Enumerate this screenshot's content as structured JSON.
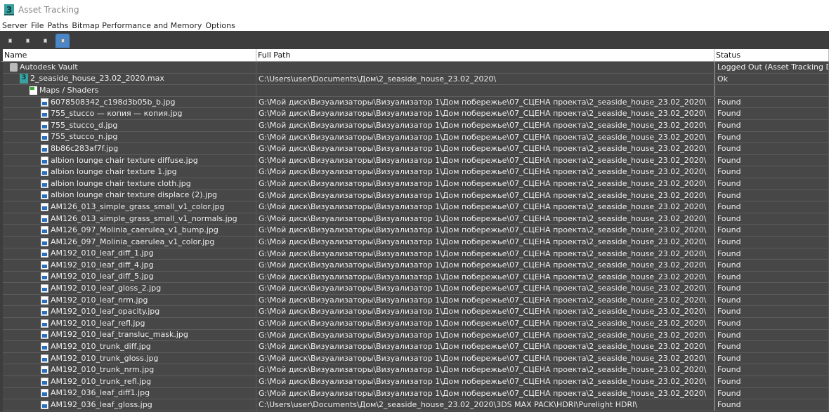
{
  "window": {
    "title": "Asset Tracking"
  },
  "menu": [
    "Server",
    "File",
    "Paths",
    "Bitmap Performance and Memory",
    "Options"
  ],
  "toolbar": {
    "buttons": [
      "status-view-button",
      "list-view-button",
      "refresh-button",
      "table-view-button"
    ],
    "active_index": 3
  },
  "columns": {
    "name": "Name",
    "path": "Full Path",
    "status": "Status"
  },
  "rows": [
    {
      "level": 0,
      "icon": "vault",
      "name": "Autodesk Vault",
      "path": "",
      "status": "Logged Out (Asset Tracking Disa"
    },
    {
      "level": 1,
      "icon": "max",
      "name": "2_seaside_house_23.02_2020.max",
      "path": "C:\\Users\\user\\Documents\\Дом\\2_seaside_house_23.02_2020\\",
      "status": "Ok"
    },
    {
      "level": 2,
      "icon": "maps",
      "name": "Maps / Shaders",
      "path": "",
      "status": ""
    },
    {
      "level": 3,
      "icon": "img",
      "name": "6078508342_c198d3b05b_b.jpg",
      "path": "G:\\Мой диск\\Визуализаторы\\Визуализатор 1\\Дом побережье\\07_СЦЕНА проекта\\2_seaside_house_23.02_2020\\",
      "status": "Found"
    },
    {
      "level": 3,
      "icon": "img",
      "name": "755_stucco — копия — копия.jpg",
      "path": "G:\\Мой диск\\Визуализаторы\\Визуализатор 1\\Дом побережье\\07_СЦЕНА проекта\\2_seaside_house_23.02_2020\\",
      "status": "Found"
    },
    {
      "level": 3,
      "icon": "img",
      "name": "755_stucco_d.jpg",
      "path": "G:\\Мой диск\\Визуализаторы\\Визуализатор 1\\Дом побережье\\07_СЦЕНА проекта\\2_seaside_house_23.02_2020\\",
      "status": "Found"
    },
    {
      "level": 3,
      "icon": "img",
      "name": "755_stucco_n.jpg",
      "path": "G:\\Мой диск\\Визуализаторы\\Визуализатор 1\\Дом побережье\\07_СЦЕНА проекта\\2_seaside_house_23.02_2020\\",
      "status": "Found"
    },
    {
      "level": 3,
      "icon": "img",
      "name": "8b86c283af7f.jpg",
      "path": "G:\\Мой диск\\Визуализаторы\\Визуализатор 1\\Дом побережье\\07_СЦЕНА проекта\\2_seaside_house_23.02_2020\\",
      "status": "Found"
    },
    {
      "level": 3,
      "icon": "img",
      "name": "albion lounge chair texture  diffuse.jpg",
      "path": "G:\\Мой диск\\Визуализаторы\\Визуализатор 1\\Дом побережье\\07_СЦЕНА проекта\\2_seaside_house_23.02_2020\\",
      "status": "Found"
    },
    {
      "level": 3,
      "icon": "img",
      "name": "albion lounge chair texture 1.jpg",
      "path": "G:\\Мой диск\\Визуализаторы\\Визуализатор 1\\Дом побережье\\07_СЦЕНА проекта\\2_seaside_house_23.02_2020\\",
      "status": "Found"
    },
    {
      "level": 3,
      "icon": "img",
      "name": "albion lounge chair texture cloth.jpg",
      "path": "G:\\Мой диск\\Визуализаторы\\Визуализатор 1\\Дом побережье\\07_СЦЕНА проекта\\2_seaside_house_23.02_2020\\",
      "status": "Found"
    },
    {
      "level": 3,
      "icon": "img",
      "name": "albion lounge chair texture displace (2).jpg",
      "path": "G:\\Мой диск\\Визуализаторы\\Визуализатор 1\\Дом побережье\\07_СЦЕНА проекта\\2_seaside_house_23.02_2020\\",
      "status": "Found"
    },
    {
      "level": 3,
      "icon": "img",
      "name": "AM126_013_simple_grass_small_v1_color.jpg",
      "path": "G:\\Мой диск\\Визуализаторы\\Визуализатор 1\\Дом побережье\\07_СЦЕНА проекта\\2_seaside_house_23.02_2020\\",
      "status": "Found"
    },
    {
      "level": 3,
      "icon": "img",
      "name": "AM126_013_simple_grass_small_v1_normals.jpg",
      "path": "G:\\Мой диск\\Визуализаторы\\Визуализатор 1\\Дом побережье\\07_СЦЕНА проекта\\2_seaside_house_23.02_2020\\",
      "status": "Found"
    },
    {
      "level": 3,
      "icon": "img",
      "name": "AM126_097_Molinia_caerulea_v1_bump.jpg",
      "path": "G:\\Мой диск\\Визуализаторы\\Визуализатор 1\\Дом побережье\\07_СЦЕНА проекта\\2_seaside_house_23.02_2020\\",
      "status": "Found"
    },
    {
      "level": 3,
      "icon": "img",
      "name": "AM126_097_Molinia_caerulea_v1_color.jpg",
      "path": "G:\\Мой диск\\Визуализаторы\\Визуализатор 1\\Дом побережье\\07_СЦЕНА проекта\\2_seaside_house_23.02_2020\\",
      "status": "Found"
    },
    {
      "level": 3,
      "icon": "img",
      "name": "AM192_010_leaf_diff_1.jpg",
      "path": "G:\\Мой диск\\Визуализаторы\\Визуализатор 1\\Дом побережье\\07_СЦЕНА проекта\\2_seaside_house_23.02_2020\\",
      "status": "Found"
    },
    {
      "level": 3,
      "icon": "img",
      "name": "AM192_010_leaf_diff_4.jpg",
      "path": "G:\\Мой диск\\Визуализаторы\\Визуализатор 1\\Дом побережье\\07_СЦЕНА проекта\\2_seaside_house_23.02_2020\\",
      "status": "Found"
    },
    {
      "level": 3,
      "icon": "img",
      "name": "AM192_010_leaf_diff_5.jpg",
      "path": "G:\\Мой диск\\Визуализаторы\\Визуализатор 1\\Дом побережье\\07_СЦЕНА проекта\\2_seaside_house_23.02_2020\\",
      "status": "Found"
    },
    {
      "level": 3,
      "icon": "img",
      "name": "AM192_010_leaf_gloss_2.jpg",
      "path": "G:\\Мой диск\\Визуализаторы\\Визуализатор 1\\Дом побережье\\07_СЦЕНА проекта\\2_seaside_house_23.02_2020\\",
      "status": "Found"
    },
    {
      "level": 3,
      "icon": "img",
      "name": "AM192_010_leaf_nrm.jpg",
      "path": "G:\\Мой диск\\Визуализаторы\\Визуализатор 1\\Дом побережье\\07_СЦЕНА проекта\\2_seaside_house_23.02_2020\\",
      "status": "Found"
    },
    {
      "level": 3,
      "icon": "img",
      "name": "AM192_010_leaf_opacity.jpg",
      "path": "G:\\Мой диск\\Визуализаторы\\Визуализатор 1\\Дом побережье\\07_СЦЕНА проекта\\2_seaside_house_23.02_2020\\",
      "status": "Found"
    },
    {
      "level": 3,
      "icon": "img",
      "name": "AM192_010_leaf_refl.jpg",
      "path": "G:\\Мой диск\\Визуализаторы\\Визуализатор 1\\Дом побережье\\07_СЦЕНА проекта\\2_seaside_house_23.02_2020\\",
      "status": "Found"
    },
    {
      "level": 3,
      "icon": "img",
      "name": "AM192_010_leaf_transluc_mask.jpg",
      "path": "G:\\Мой диск\\Визуализаторы\\Визуализатор 1\\Дом побережье\\07_СЦЕНА проекта\\2_seaside_house_23.02_2020\\",
      "status": "Found"
    },
    {
      "level": 3,
      "icon": "img",
      "name": "AM192_010_trunk_diff.jpg",
      "path": "G:\\Мой диск\\Визуализаторы\\Визуализатор 1\\Дом побережье\\07_СЦЕНА проекта\\2_seaside_house_23.02_2020\\",
      "status": "Found"
    },
    {
      "level": 3,
      "icon": "img",
      "name": "AM192_010_trunk_gloss.jpg",
      "path": "G:\\Мой диск\\Визуализаторы\\Визуализатор 1\\Дом побережье\\07_СЦЕНА проекта\\2_seaside_house_23.02_2020\\",
      "status": "Found"
    },
    {
      "level": 3,
      "icon": "img",
      "name": "AM192_010_trunk_nrm.jpg",
      "path": "G:\\Мой диск\\Визуализаторы\\Визуализатор 1\\Дом побережье\\07_СЦЕНА проекта\\2_seaside_house_23.02_2020\\",
      "status": "Found"
    },
    {
      "level": 3,
      "icon": "img",
      "name": "AM192_010_trunk_refl.jpg",
      "path": "G:\\Мой диск\\Визуализаторы\\Визуализатор 1\\Дом побережье\\07_СЦЕНА проекта\\2_seaside_house_23.02_2020\\",
      "status": "Found"
    },
    {
      "level": 3,
      "icon": "img",
      "name": "AM192_036_leaf_diff1.jpg",
      "path": "G:\\Мой диск\\Визуализаторы\\Визуализатор 1\\Дом побережье\\07_СЦЕНА проекта\\2_seaside_house_23.02_2020\\",
      "status": "Found"
    },
    {
      "level": 3,
      "icon": "img",
      "name": "AM192_036_leaf_gloss.jpg",
      "path": "C:\\Users\\user\\Documents\\Дом\\2_seaside_house_23.02_2020\\3DS MAX PACK\\HDRI\\Purelight HDRI\\",
      "status": "Found"
    }
  ]
}
